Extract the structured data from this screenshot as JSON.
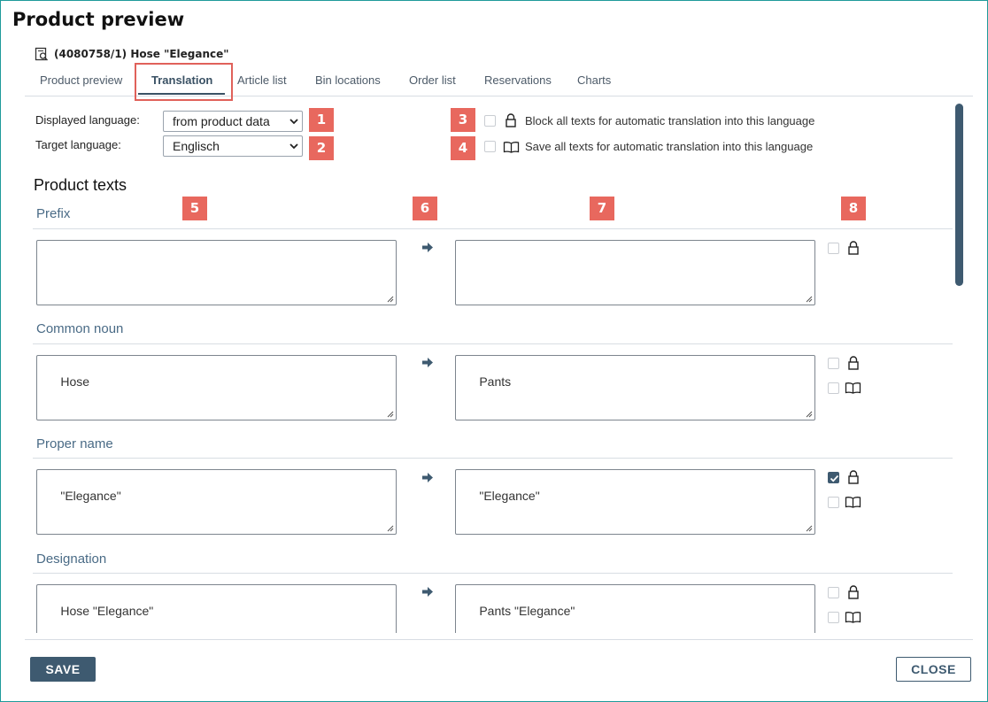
{
  "window": {
    "title": "Product preview"
  },
  "product": {
    "heading": "(4080758/1) Hose \"Elegance\""
  },
  "tabs": [
    {
      "label": "Product preview"
    },
    {
      "label": "Translation",
      "active": true
    },
    {
      "label": "Article list"
    },
    {
      "label": "Bin locations"
    },
    {
      "label": "Order list"
    },
    {
      "label": "Reservations"
    },
    {
      "label": "Charts"
    }
  ],
  "settings": {
    "displayed_language_label": "Displayed language:",
    "displayed_language_value": "from product data",
    "target_language_label": "Target language:",
    "target_language_value": "Englisch",
    "block_all_label": "Block all texts for automatic translation into this language",
    "block_all_checked": false,
    "save_all_label": "Save all texts for automatic translation into this language",
    "save_all_checked": false
  },
  "badges": [
    "1",
    "2",
    "3",
    "4",
    "5",
    "6",
    "7",
    "8"
  ],
  "section": {
    "title": "Product texts"
  },
  "fields": [
    {
      "label": "Prefix",
      "source": "",
      "target": "",
      "lock_checked": false,
      "has_dictionary": false
    },
    {
      "label": "Common noun",
      "source": "Hose",
      "target": "Pants",
      "lock_checked": false,
      "dict_checked": false,
      "has_dictionary": true
    },
    {
      "label": "Proper name",
      "source": "\"Elegance\"",
      "target": "\"Elegance\"",
      "lock_checked": true,
      "dict_checked": false,
      "has_dictionary": true
    },
    {
      "label": "Designation",
      "source": "Hose \"Elegance\"",
      "target": "Pants \"Elegance\"",
      "lock_checked": false,
      "dict_checked": false,
      "has_dictionary": true
    }
  ],
  "footer": {
    "save_label": "SAVE",
    "close_label": "CLOSE"
  },
  "colors": {
    "accent": "#3e5a70",
    "badge": "#e8685e",
    "highlight": "#e0615a",
    "field_label": "#4a6b86"
  }
}
